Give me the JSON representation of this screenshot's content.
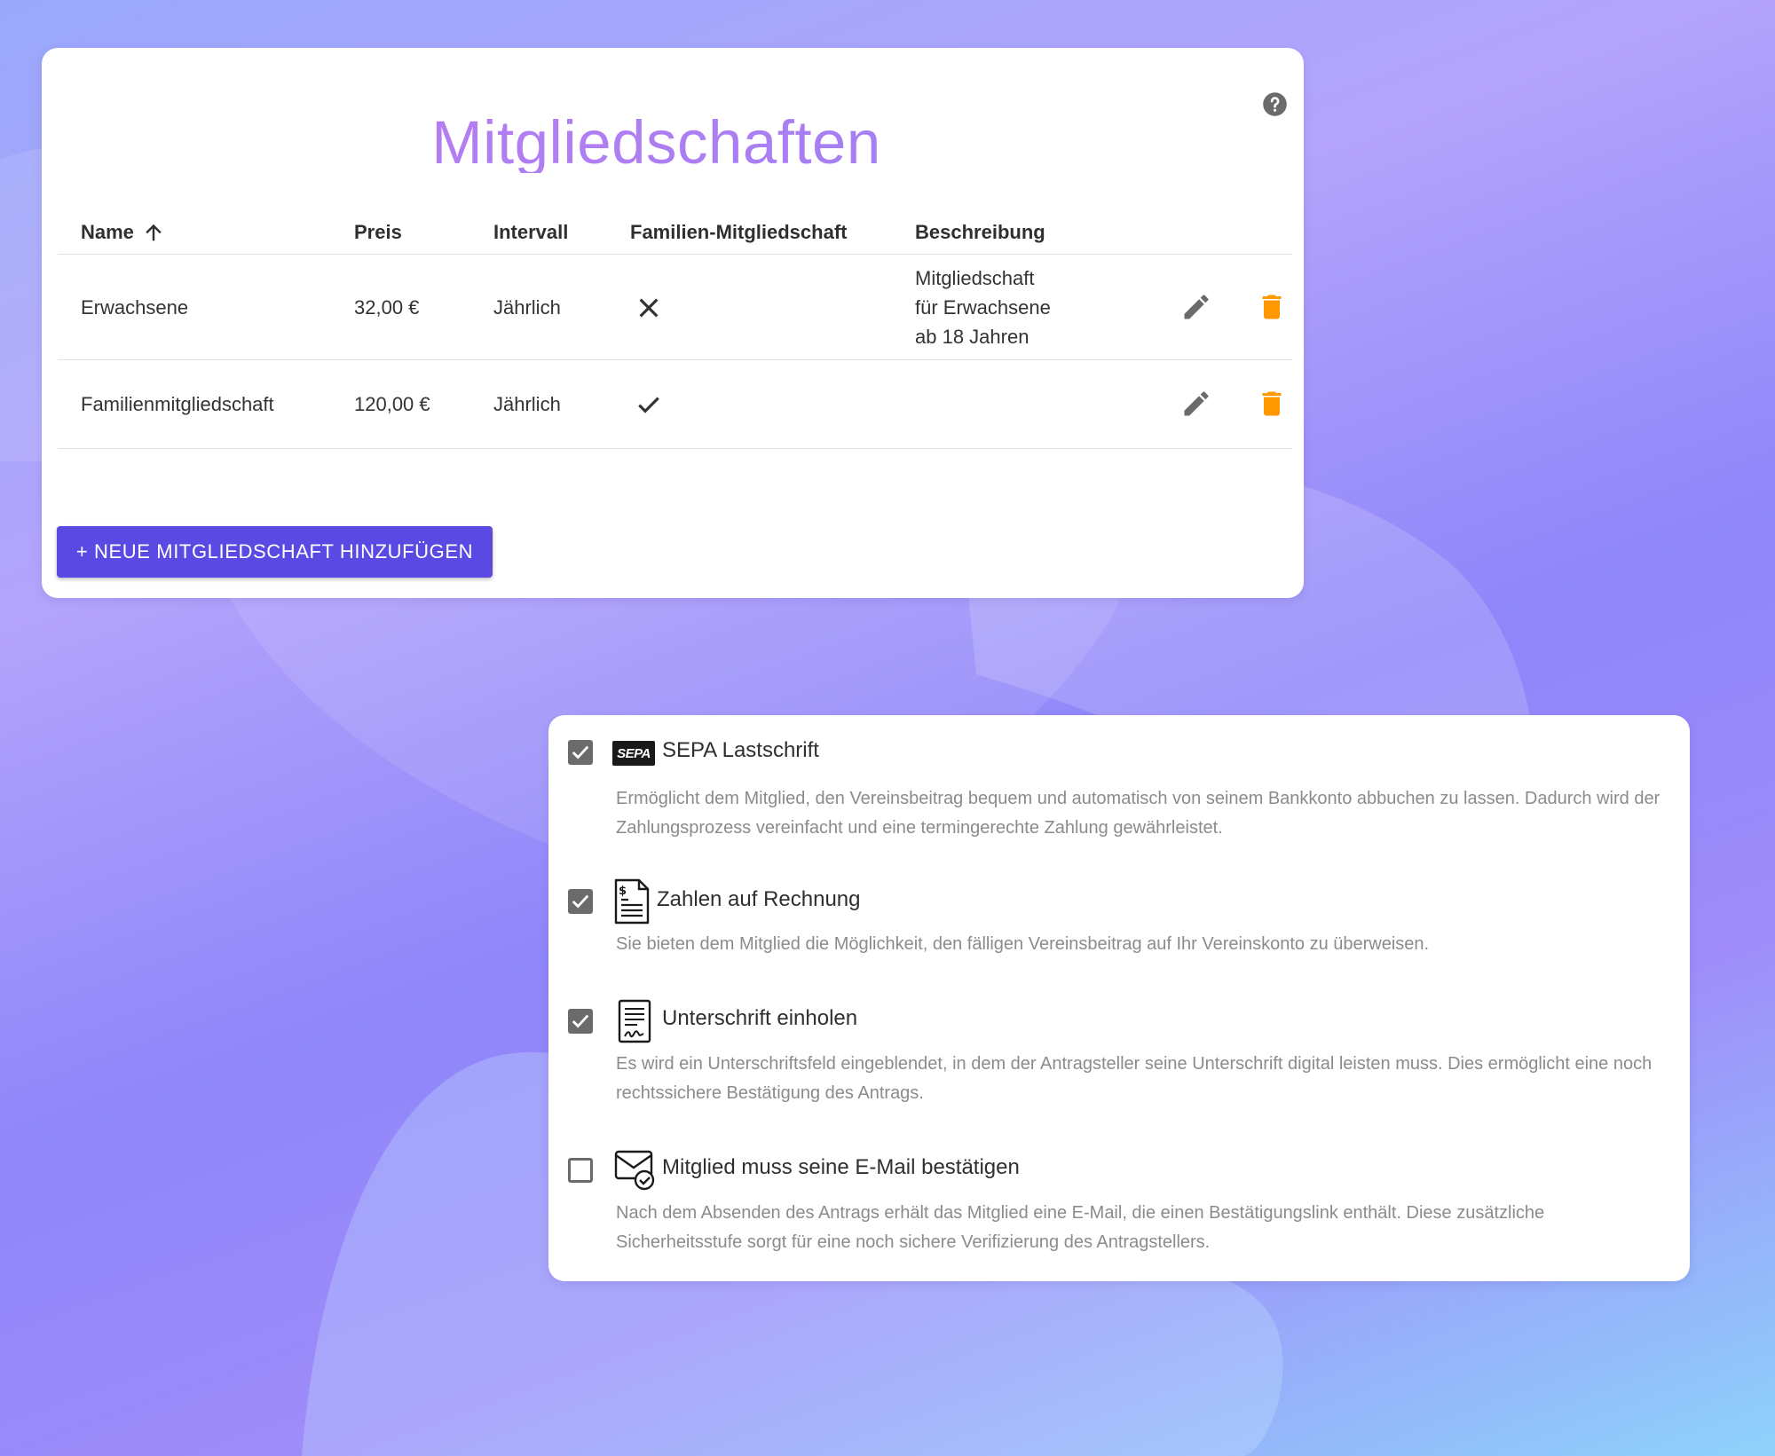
{
  "membership_panel": {
    "title": "Mitgliedschaften",
    "help_icon": "help-circle-icon",
    "table": {
      "columns": {
        "name": "Name",
        "price": "Preis",
        "interval": "Intervall",
        "family": "Familien-Mitgliedschaft",
        "description": "Beschreibung"
      },
      "sort_icon": "arrow-up-icon",
      "rows": [
        {
          "name": "Erwachsene",
          "price": "32,00 €",
          "interval": "Jährlich",
          "family": false,
          "description_lines": [
            "Mitgliedschaft",
            "für Erwachsene",
            "ab 18 Jahren"
          ]
        },
        {
          "name": "Familienmitgliedschaft",
          "price": "120,00 €",
          "interval": "Jährlich",
          "family": true,
          "description_lines": []
        }
      ],
      "row_actions": [
        "pencil-icon",
        "trash-icon"
      ]
    },
    "add_button_label": "+ NEUE MITGLIEDSCHAFT HINZUFÜGEN"
  },
  "payment_panel": {
    "options": [
      {
        "checked": true,
        "icon": "sepa-logo",
        "logo_text": "SEPA",
        "title": "SEPA Lastschrift",
        "description": "Ermöglicht dem Mitglied, den Vereinsbeitrag bequem und automatisch von seinem Bankkonto abbuchen zu lassen. Dadurch wird der Zahlungsprozess vereinfacht und eine termingerechte Zahlung gewährleistet."
      },
      {
        "checked": true,
        "icon": "invoice-document-icon",
        "title": "Zahlen auf Rechnung",
        "description": "Sie bieten dem Mitglied die Möglichkeit, den fälligen Vereinsbeitrag auf Ihr Vereinskonto zu überweisen."
      },
      {
        "checked": true,
        "icon": "signature-document-icon",
        "title": "Unterschrift einholen",
        "description": "Es wird ein Unterschriftsfeld eingeblendet, in dem der Antragsteller seine Unterschrift digital leisten muss. Dies ermöglicht eine noch rechtssichere Bestätigung des Antrags."
      },
      {
        "checked": false,
        "icon": "email-verified-icon",
        "title": "Mitglied muss seine E-Mail bestätigen",
        "description": "Nach dem Absenden des Antrags erhält das Mitglied eine E-Mail, die einen Bestätigungslink enthält. Diese zusätzliche Sicherheitsstufe sorgt für eine noch sichere Verifizierung des Antragstellers."
      }
    ]
  },
  "colors": {
    "title_gradient_start": "#c07af0",
    "title_gradient_end": "#9a82f4",
    "primary_button": "#5b49e3",
    "delete_icon": "#ff9800",
    "icon_gray": "#6b6b6b",
    "description_text": "#8b8b8b"
  }
}
